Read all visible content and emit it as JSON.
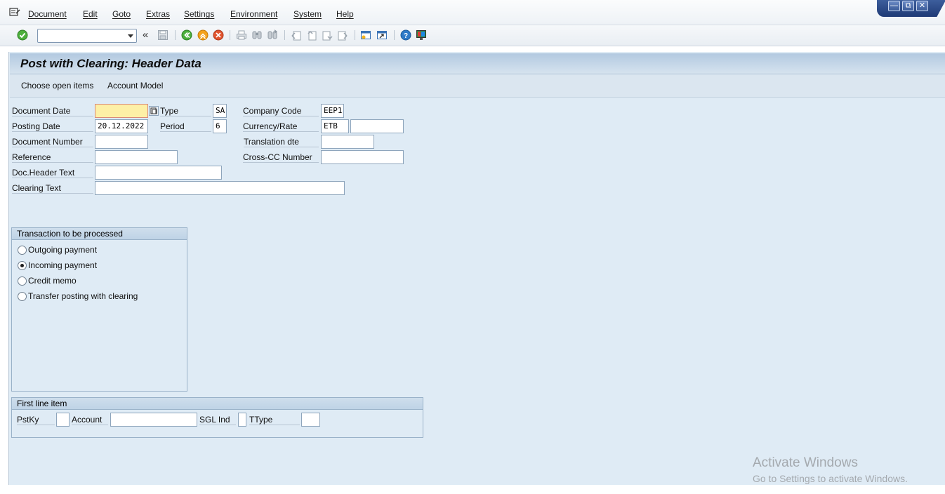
{
  "menu": {
    "items": [
      "Document",
      "Edit",
      "Goto",
      "Extras",
      "Settings",
      "Environment",
      "System",
      "Help"
    ]
  },
  "toolbar": {
    "command_field_value": "",
    "icons": [
      "enter-icon",
      "back-icon",
      "save-icon",
      "back-green-icon",
      "exit-icon",
      "cancel-icon",
      "print-icon",
      "find-icon",
      "find-next-icon",
      "first-page-icon",
      "prev-page-icon",
      "next-page-icon",
      "last-page-icon",
      "new-session-icon",
      "shortcut-icon",
      "help-icon",
      "customize-layout-icon"
    ]
  },
  "title": "Post with Clearing: Header Data",
  "app_toolbar": {
    "choose_open_items": "Choose open items",
    "account_model": "Account Model"
  },
  "header": {
    "document_date": {
      "label": "Document Date",
      "value": ""
    },
    "type": {
      "label": "Type",
      "value": "SA"
    },
    "company_code": {
      "label": "Company Code",
      "value": "EEP1"
    },
    "posting_date": {
      "label": "Posting Date",
      "value": "20.12.2022"
    },
    "period": {
      "label": "Period",
      "value": "6"
    },
    "currency_rate": {
      "label": "Currency/Rate",
      "currency": "ETB",
      "rate": ""
    },
    "document_number": {
      "label": "Document Number",
      "value": ""
    },
    "translation_dte": {
      "label": "Translation dte",
      "value": ""
    },
    "reference": {
      "label": "Reference",
      "value": ""
    },
    "cross_cc_number": {
      "label": "Cross-CC Number",
      "value": ""
    },
    "doc_header_text": {
      "label": "Doc.Header Text",
      "value": ""
    },
    "clearing_text": {
      "label": "Clearing Text",
      "value": ""
    }
  },
  "transaction": {
    "title": "Transaction to be processed",
    "options": [
      {
        "label": "Outgoing payment",
        "selected": false
      },
      {
        "label": "Incoming payment",
        "selected": true
      },
      {
        "label": "Credit memo",
        "selected": false
      },
      {
        "label": "Transfer posting with clearing",
        "selected": false
      }
    ]
  },
  "first_line_item": {
    "title": "First line item",
    "pstky": {
      "label": "PstKy",
      "value": ""
    },
    "account": {
      "label": "Account",
      "value": ""
    },
    "sgl_ind": {
      "label": "SGL Ind",
      "value": ""
    },
    "ttype": {
      "label": "TType",
      "value": ""
    }
  },
  "watermark": {
    "line1": "Activate Windows",
    "line2": "Go to Settings to activate Windows."
  },
  "colors": {
    "main_bg": "#dfebf5",
    "title_bar": "#b2c9e0",
    "focus_field": "#fdf0a6"
  }
}
